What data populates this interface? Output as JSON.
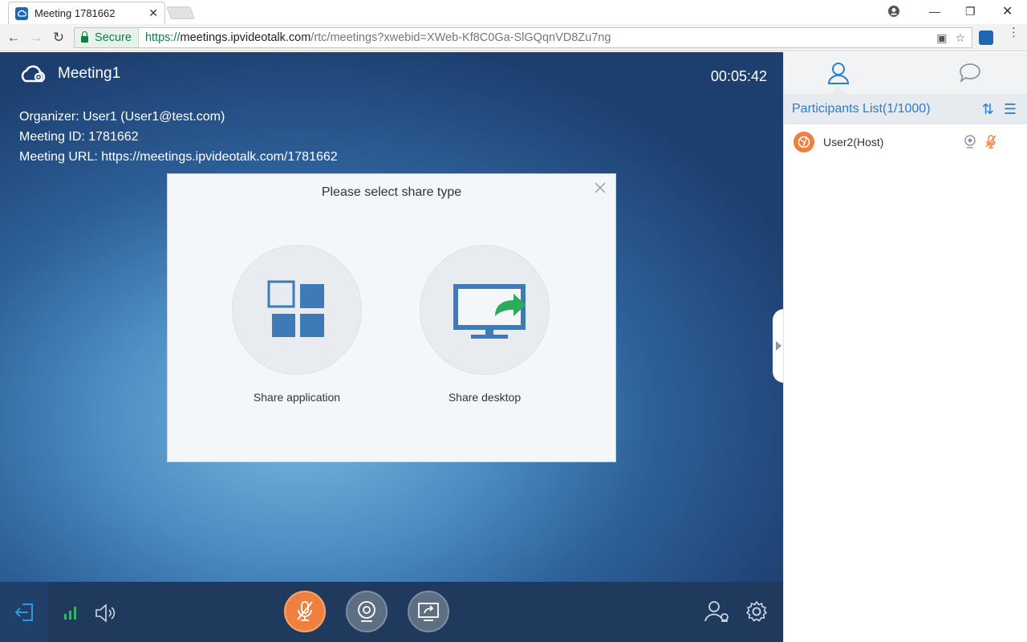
{
  "browser": {
    "tab_title": "Meeting 1781662",
    "secure_label": "Secure",
    "url_proto": "https://",
    "url_host": "meetings.ipvideotalk.com",
    "url_path": "/rtc/meetings?xwebid=XWeb-Kf8C0Ga-SlGQqnVD8Zu7ng"
  },
  "meeting": {
    "title": "Meeting1",
    "timer": "00:05:42",
    "organizer": "Organizer: User1 (User1@test.com)",
    "meeting_id": "Meeting ID: 1781662",
    "meeting_url": "Meeting URL: https://meetings.ipvideotalk.com/1781662"
  },
  "share_dialog": {
    "title": "Please select share type",
    "options": [
      {
        "label": "Share application",
        "icon": "share-application-icon"
      },
      {
        "label": "Share desktop",
        "icon": "share-desktop-icon"
      }
    ]
  },
  "participants": {
    "title": "Participants List(1/1000)",
    "list": [
      {
        "name": "User2(Host)"
      }
    ]
  },
  "colors": {
    "accent": "#2b7cd3",
    "mic_muted": "#f08040",
    "toolbar_bg": "#1f3a5d",
    "share_icon": "#3d7ab6",
    "share_arrow": "#2eaa5d"
  }
}
